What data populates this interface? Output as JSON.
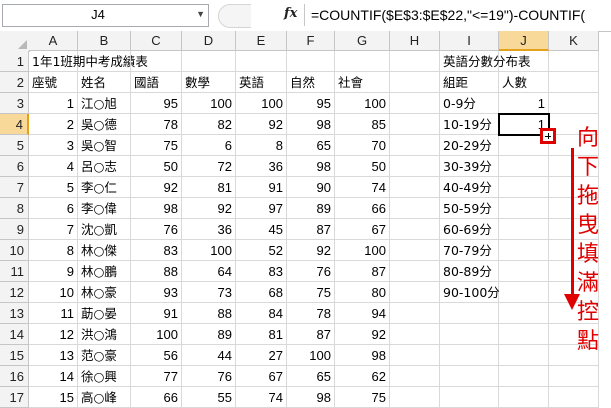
{
  "formula_bar": {
    "name_box": "J4",
    "fx_label": "fx",
    "formula": "=COUNTIF($E$3:$E$22,\"<=19\")-COUNTIF("
  },
  "columns": [
    "A",
    "B",
    "C",
    "D",
    "E",
    "F",
    "G",
    "H",
    "I",
    "J",
    "K"
  ],
  "active_column": "J",
  "rows": [
    {
      "n": "1",
      "cells": {
        "A": "1年1班期中考成績表",
        "I": "英語分數分布表"
      }
    },
    {
      "n": "2",
      "cells": {
        "A": "座號",
        "B": "姓名",
        "C": "國語",
        "D": "數學",
        "E": "英語",
        "F": "自然",
        "G": "社會",
        "I": "組距",
        "J": "人數"
      }
    },
    {
      "n": "3",
      "cells": {
        "A": "1",
        "B": "江○旭",
        "C": "95",
        "D": "100",
        "E": "100",
        "F": "95",
        "G": "100",
        "I": "0-9分",
        "J": "1"
      }
    },
    {
      "n": "4",
      "cells": {
        "A": "2",
        "B": "吳○德",
        "C": "78",
        "D": "82",
        "E": "92",
        "F": "98",
        "G": "85",
        "I": "10-19分",
        "J": "1"
      }
    },
    {
      "n": "5",
      "cells": {
        "A": "3",
        "B": "吳○智",
        "C": "75",
        "D": "6",
        "E": "8",
        "F": "65",
        "G": "70",
        "I": "20-29分"
      }
    },
    {
      "n": "6",
      "cells": {
        "A": "4",
        "B": "呂○志",
        "C": "50",
        "D": "72",
        "E": "36",
        "F": "98",
        "G": "50",
        "I": "30-39分"
      }
    },
    {
      "n": "7",
      "cells": {
        "A": "5",
        "B": "李○仁",
        "C": "92",
        "D": "81",
        "E": "91",
        "F": "90",
        "G": "74",
        "I": "40-49分"
      }
    },
    {
      "n": "8",
      "cells": {
        "A": "6",
        "B": "李○偉",
        "C": "98",
        "D": "92",
        "E": "97",
        "F": "89",
        "G": "66",
        "I": "50-59分"
      }
    },
    {
      "n": "9",
      "cells": {
        "A": "7",
        "B": "沈○凱",
        "C": "76",
        "D": "36",
        "E": "45",
        "F": "87",
        "G": "67",
        "I": "60-69分"
      }
    },
    {
      "n": "10",
      "cells": {
        "A": "8",
        "B": "林○傑",
        "C": "83",
        "D": "100",
        "E": "52",
        "F": "92",
        "G": "100",
        "I": "70-79分"
      }
    },
    {
      "n": "11",
      "cells": {
        "A": "9",
        "B": "林○鵬",
        "C": "88",
        "D": "64",
        "E": "83",
        "F": "76",
        "G": "87",
        "I": "80-89分"
      }
    },
    {
      "n": "12",
      "cells": {
        "A": "10",
        "B": "林○豪",
        "C": "93",
        "D": "73",
        "E": "68",
        "F": "75",
        "G": "80",
        "I": "90-100分"
      }
    },
    {
      "n": "13",
      "cells": {
        "A": "11",
        "B": "莇○晏",
        "C": "91",
        "D": "88",
        "E": "84",
        "F": "78",
        "G": "94"
      }
    },
    {
      "n": "14",
      "cells": {
        "A": "12",
        "B": "洪○鴻",
        "C": "100",
        "D": "89",
        "E": "81",
        "F": "87",
        "G": "92"
      }
    },
    {
      "n": "15",
      "cells": {
        "A": "13",
        "B": "范○豪",
        "C": "56",
        "D": "44",
        "E": "27",
        "F": "100",
        "G": "98"
      }
    },
    {
      "n": "16",
      "cells": {
        "A": "14",
        "B": "徐○興",
        "C": "77",
        "D": "76",
        "E": "67",
        "F": "65",
        "G": "62"
      }
    },
    {
      "n": "17",
      "cells": {
        "A": "15",
        "B": "高○峰",
        "C": "66",
        "D": "55",
        "E": "74",
        "F": "98",
        "G": "75"
      }
    }
  ],
  "selected_cell": "J4",
  "annotation": {
    "text": "向下拖曳填滿控點",
    "color": "#e00000"
  },
  "colors": {
    "header_bg": "#f3f3f3",
    "active_header": "#f9d99a",
    "gridline": "#d9d9d9"
  }
}
